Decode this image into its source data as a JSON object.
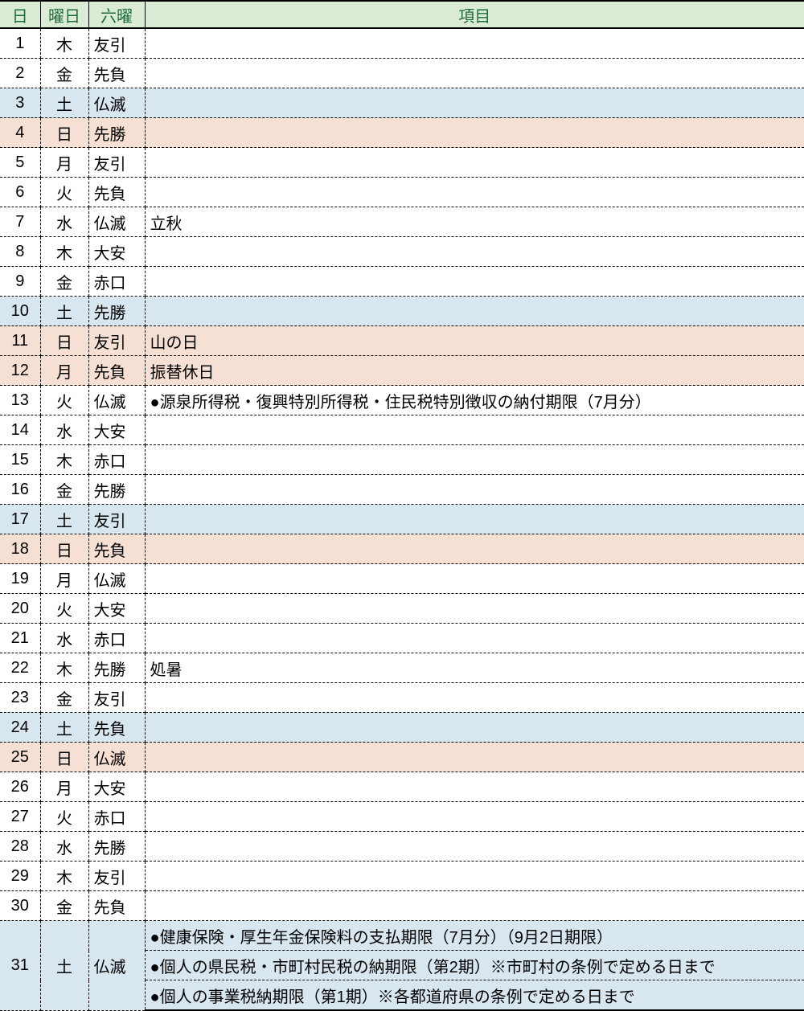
{
  "headers": {
    "day": "日",
    "weekday": "曜日",
    "rokuyo": "六曜",
    "item": "項目"
  },
  "rows": [
    {
      "day": "1",
      "weekday": "木",
      "rokuyo": "友引",
      "type": "weekday",
      "items": []
    },
    {
      "day": "2",
      "weekday": "金",
      "rokuyo": "先負",
      "type": "weekday",
      "items": []
    },
    {
      "day": "3",
      "weekday": "土",
      "rokuyo": "仏滅",
      "type": "saturday",
      "items": []
    },
    {
      "day": "4",
      "weekday": "日",
      "rokuyo": "先勝",
      "type": "sunday",
      "items": []
    },
    {
      "day": "5",
      "weekday": "月",
      "rokuyo": "友引",
      "type": "weekday",
      "items": []
    },
    {
      "day": "6",
      "weekday": "火",
      "rokuyo": "先負",
      "type": "weekday",
      "items": []
    },
    {
      "day": "7",
      "weekday": "水",
      "rokuyo": "仏滅",
      "type": "weekday",
      "items": [
        "立秋"
      ]
    },
    {
      "day": "8",
      "weekday": "木",
      "rokuyo": "大安",
      "type": "weekday",
      "items": []
    },
    {
      "day": "9",
      "weekday": "金",
      "rokuyo": "赤口",
      "type": "weekday",
      "items": []
    },
    {
      "day": "10",
      "weekday": "土",
      "rokuyo": "先勝",
      "type": "saturday",
      "items": []
    },
    {
      "day": "11",
      "weekday": "日",
      "rokuyo": "友引",
      "type": "sunday",
      "items": [
        "山の日"
      ]
    },
    {
      "day": "12",
      "weekday": "月",
      "rokuyo": "先負",
      "type": "holiday",
      "items": [
        "振替休日"
      ]
    },
    {
      "day": "13",
      "weekday": "火",
      "rokuyo": "仏滅",
      "type": "weekday",
      "items": [
        "●源泉所得税・復興特別所得税・住民税特別徴収の納付期限（7月分）"
      ]
    },
    {
      "day": "14",
      "weekday": "水",
      "rokuyo": "大安",
      "type": "weekday",
      "items": []
    },
    {
      "day": "15",
      "weekday": "木",
      "rokuyo": "赤口",
      "type": "weekday",
      "items": []
    },
    {
      "day": "16",
      "weekday": "金",
      "rokuyo": "先勝",
      "type": "weekday",
      "items": []
    },
    {
      "day": "17",
      "weekday": "土",
      "rokuyo": "友引",
      "type": "saturday",
      "items": []
    },
    {
      "day": "18",
      "weekday": "日",
      "rokuyo": "先負",
      "type": "sunday",
      "items": []
    },
    {
      "day": "19",
      "weekday": "月",
      "rokuyo": "仏滅",
      "type": "weekday",
      "items": []
    },
    {
      "day": "20",
      "weekday": "火",
      "rokuyo": "大安",
      "type": "weekday",
      "items": []
    },
    {
      "day": "21",
      "weekday": "水",
      "rokuyo": "赤口",
      "type": "weekday",
      "items": []
    },
    {
      "day": "22",
      "weekday": "木",
      "rokuyo": "先勝",
      "type": "weekday",
      "items": [
        "処暑"
      ]
    },
    {
      "day": "23",
      "weekday": "金",
      "rokuyo": "友引",
      "type": "weekday",
      "items": []
    },
    {
      "day": "24",
      "weekday": "土",
      "rokuyo": "先負",
      "type": "saturday",
      "items": []
    },
    {
      "day": "25",
      "weekday": "日",
      "rokuyo": "仏滅",
      "type": "sunday",
      "items": []
    },
    {
      "day": "26",
      "weekday": "月",
      "rokuyo": "大安",
      "type": "weekday",
      "items": []
    },
    {
      "day": "27",
      "weekday": "火",
      "rokuyo": "赤口",
      "type": "weekday",
      "items": []
    },
    {
      "day": "28",
      "weekday": "水",
      "rokuyo": "先勝",
      "type": "weekday",
      "items": []
    },
    {
      "day": "29",
      "weekday": "木",
      "rokuyo": "友引",
      "type": "weekday",
      "items": []
    },
    {
      "day": "30",
      "weekday": "金",
      "rokuyo": "先負",
      "type": "weekday",
      "items": []
    },
    {
      "day": "31",
      "weekday": "土",
      "rokuyo": "仏滅",
      "type": "saturday",
      "items": [
        "●健康保険・厚生年金保険料の支払期限（7月分）（9月2日期限）",
        "●個人の県民税・市町村民税の納期限（第2期）※市町村の条例で定める日まで",
        "●個人の事業税納期限（第1期）※各都道府県の条例で定める日まで"
      ]
    }
  ]
}
